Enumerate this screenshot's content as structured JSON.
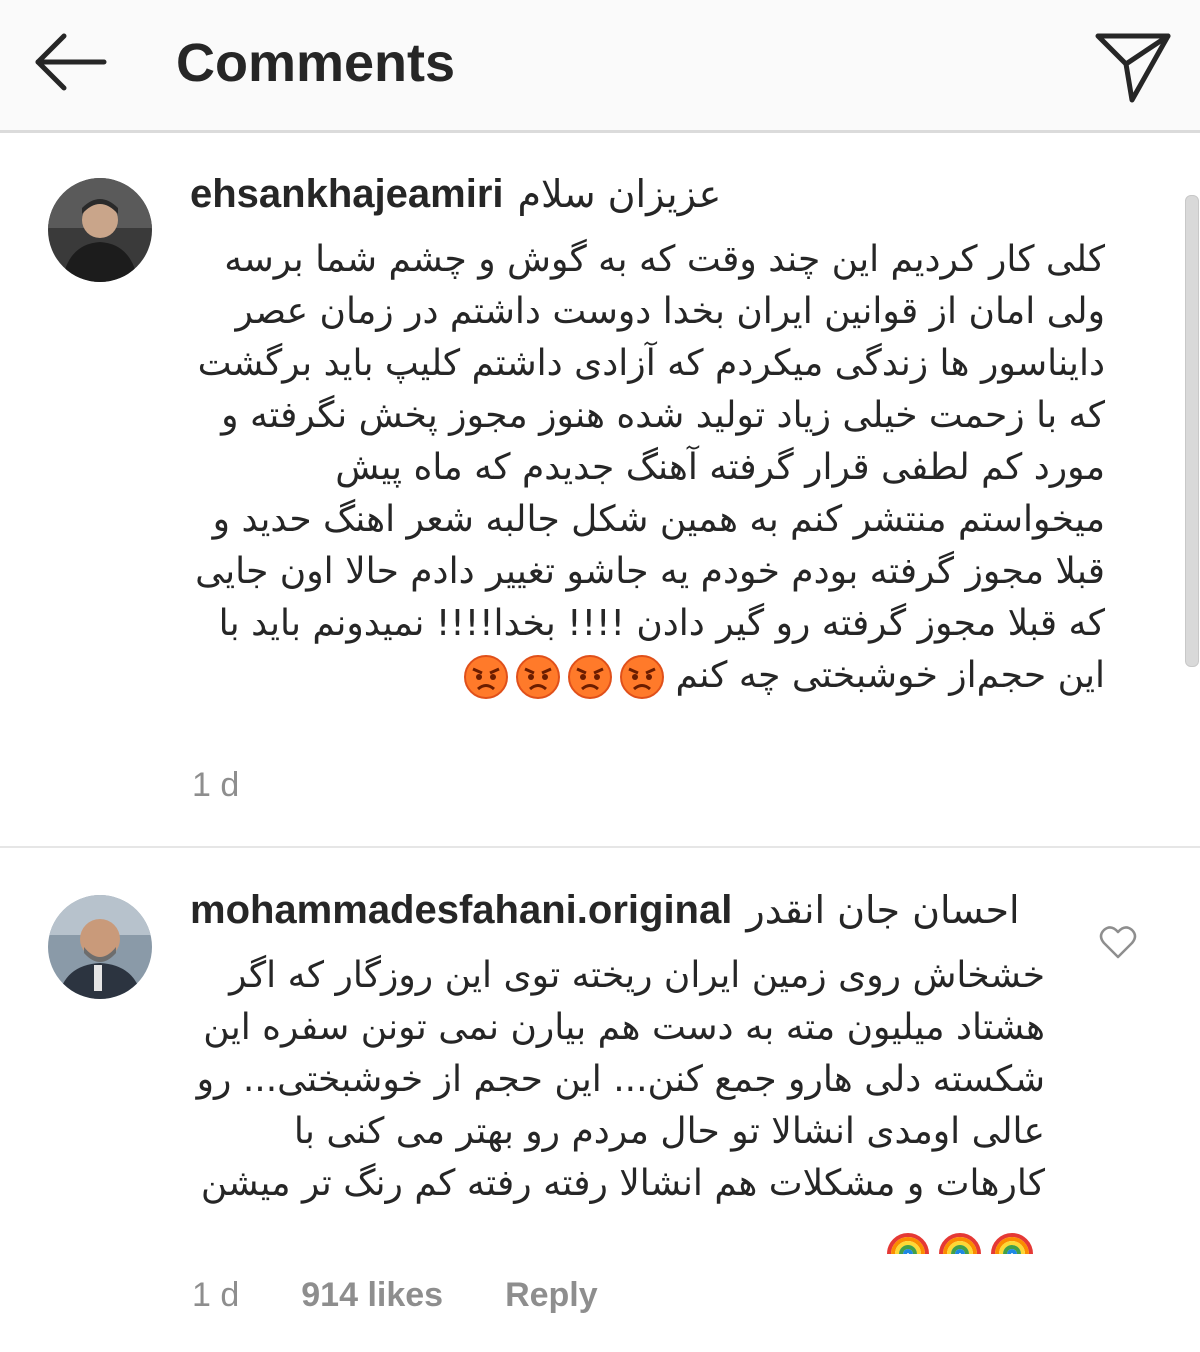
{
  "header": {
    "title": "Comments",
    "back_icon": "arrow-left-icon",
    "share_icon": "paper-plane-icon"
  },
  "comments": [
    {
      "username": "ehsankhajeamiri",
      "first_line": "عزیزان سلام",
      "text": "کلی کار کردیم این چند وقت که به گوش و چشم شما برسه ولی امان از قوانین ایران بخدا دوست داشتم در زمان عصر دایناسور ها زندگی میکردم که آزادی داشتم کلیپ باید برگشت که با زحمت خیلی زیاد تولید شده  هنوز مجوز پخش نگرفته و مورد کم لطفی قرار گرفته آهنگ جدیدم که ماه پیش میخواستم منتشر کنم به همین شکل جالبه شعر اهنگ حدید و قبلا مجوز گرفته بودم خودم یه جاشو تغییر دادم حالا اون جایی که قبلا مجوز گرفته رو گیر دادن !!!! بخدا!!!! نمیدونم باید با این حجم‌از خوشبختی چه کنم",
      "emoji_icons": [
        "angry-face-icon",
        "angry-face-icon",
        "angry-face-icon",
        "angry-face-icon"
      ],
      "time": "1 d"
    },
    {
      "username": "mohammadesfahani.original",
      "first_line": "احسان جان انقدر",
      "text": "خشخاش روی زمین ایران ریخته توی این روزگار که اگر هشتاد میلیون مته به دست هم بیارن نمی تونن سفره این شکسته دلی هارو جمع کنن... این حجم از خوشبختی... رو عالی اومدی انشالا تو حال مردم رو بهتر می کنی با کارهات و مشکلات هم انشالا رفته رفته کم رنگ تر میشن",
      "emoji_icons": [
        "rainbow-icon",
        "rainbow-icon",
        "rainbow-icon"
      ],
      "time": "1 d",
      "likes": "914 likes",
      "reply": "Reply",
      "like_icon": "heart-outline-icon"
    }
  ],
  "colors": {
    "text": "#262626",
    "muted": "#8e8e8e",
    "divider": "#dbdbdb",
    "header_bg": "#fafafa"
  }
}
